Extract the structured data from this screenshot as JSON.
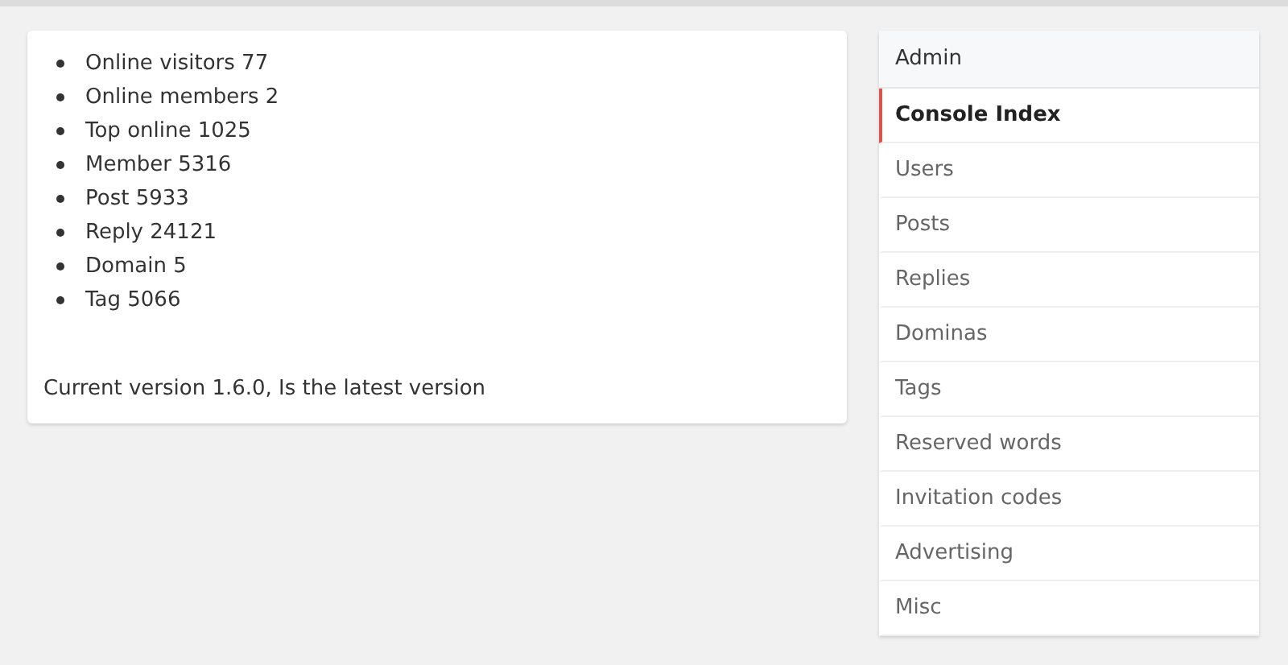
{
  "stats": [
    "Online visitors 77",
    "Online members 2",
    "Top online 1025",
    "Member 5316",
    "Post 5933",
    "Reply 24121",
    "Domain 5",
    "Tag 5066"
  ],
  "version_note": "Current version 1.6.0, Is the latest version",
  "sidebar": {
    "title": "Admin",
    "items": [
      {
        "label": "Console Index",
        "selected": true
      },
      {
        "label": "Users",
        "selected": false
      },
      {
        "label": "Posts",
        "selected": false
      },
      {
        "label": "Replies",
        "selected": false
      },
      {
        "label": "Dominas",
        "selected": false
      },
      {
        "label": "Tags",
        "selected": false
      },
      {
        "label": "Reserved words",
        "selected": false
      },
      {
        "label": "Invitation codes",
        "selected": false
      },
      {
        "label": "Advertising",
        "selected": false
      },
      {
        "label": "Misc",
        "selected": false
      }
    ]
  }
}
